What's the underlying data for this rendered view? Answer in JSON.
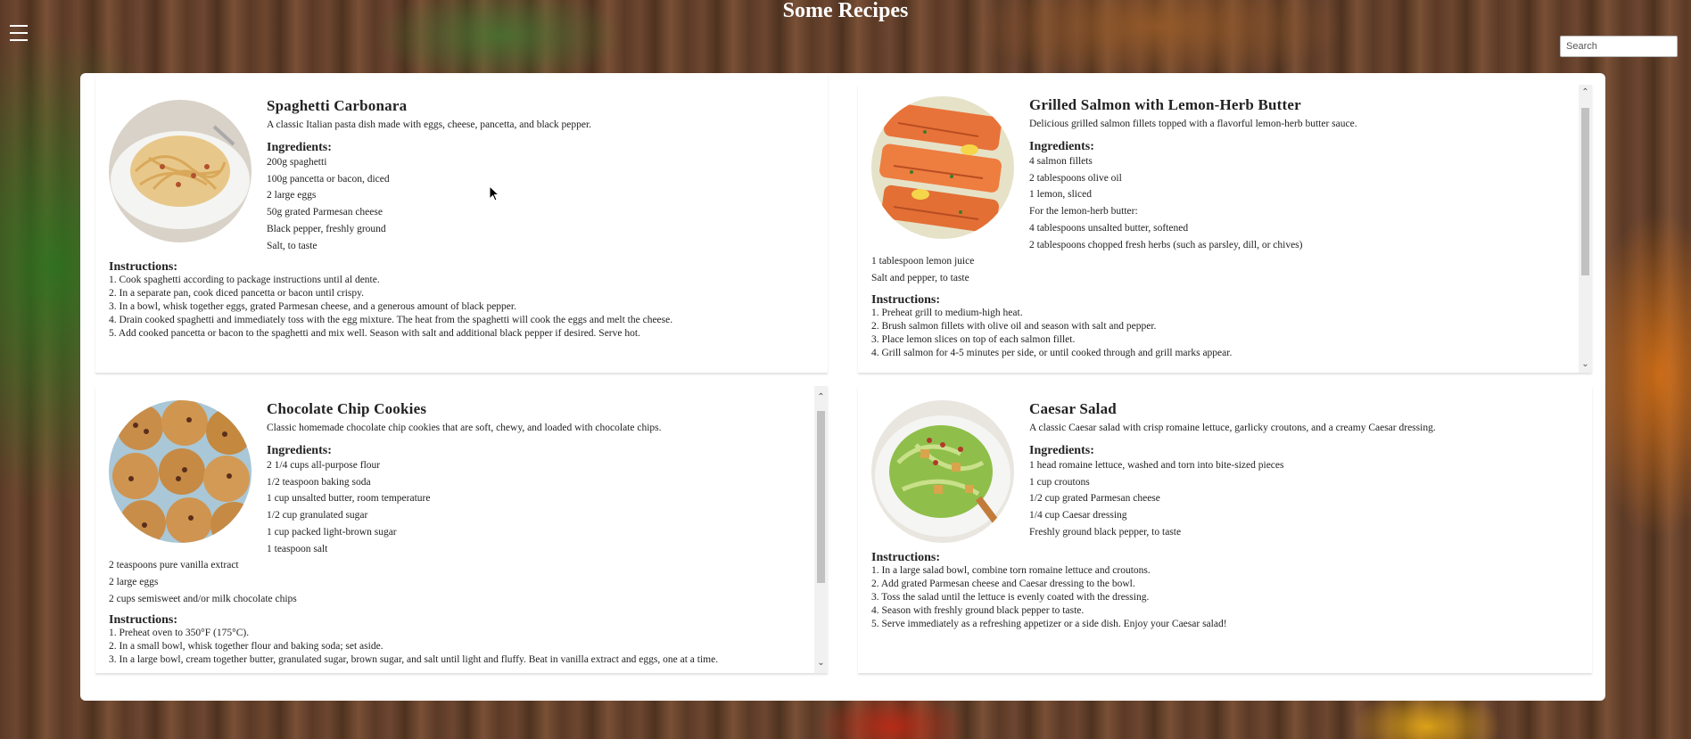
{
  "header": {
    "title": "Some Recipes",
    "search_placeholder": "Search",
    "menu_icon": "hamburger-menu-icon"
  },
  "recipes": [
    {
      "title": "Spaghetti Carbonara",
      "description": "A classic Italian pasta dish made with eggs, cheese, pancetta, and black pepper.",
      "ingredients_label": "Ingredients:",
      "ingredients": [
        "200g spaghetti",
        "100g pancetta or bacon, diced",
        "2 large eggs",
        "50g grated Parmesan cheese",
        "Black pepper, freshly ground",
        "Salt, to taste"
      ],
      "instructions_label": "Instructions:",
      "instructions": [
        "1. Cook spaghetti according to package instructions until al dente.",
        "2. In a separate pan, cook diced pancetta or bacon until crispy.",
        "3. In a bowl, whisk together eggs, grated Parmesan cheese, and a generous amount of black pepper.",
        "4. Drain cooked spaghetti and immediately toss with the egg mixture. The heat from the spaghetti will cook the eggs and melt the cheese.",
        "5. Add cooked pancetta or bacon to the spaghetti and mix well. Season with salt and additional black pepper if desired. Serve hot."
      ]
    },
    {
      "title": "Grilled Salmon with Lemon-Herb Butter",
      "description": "Delicious grilled salmon fillets topped with a flavorful lemon-herb butter sauce.",
      "ingredients_label": "Ingredients:",
      "ingredients": [
        "4 salmon fillets",
        "2 tablespoons olive oil",
        "1 lemon, sliced",
        "For the lemon-herb butter:",
        "4 tablespoons unsalted butter, softened",
        "2 tablespoons chopped fresh herbs (such as parsley, dill, or chives)",
        "1 tablespoon lemon juice",
        "Salt and pepper, to taste"
      ],
      "instructions_label": "Instructions:",
      "instructions": [
        "1. Preheat grill to medium-high heat.",
        "2. Brush salmon fillets with olive oil and season with salt and pepper.",
        "3. Place lemon slices on top of each salmon fillet.",
        "4. Grill salmon for 4-5 minutes per side, or until cooked through and grill marks appear."
      ]
    },
    {
      "title": "Chocolate Chip Cookies",
      "description": "Classic homemade chocolate chip cookies that are soft, chewy, and loaded with chocolate chips.",
      "ingredients_label": "Ingredients:",
      "ingredients": [
        "2 1/4 cups all-purpose flour",
        "1/2 teaspoon baking soda",
        "1 cup unsalted butter, room temperature",
        "1/2 cup granulated sugar",
        "1 cup packed light-brown sugar",
        "1 teaspoon salt",
        "2 teaspoons pure vanilla extract",
        "2 large eggs",
        "2 cups semisweet and/or milk chocolate chips"
      ],
      "instructions_label": "Instructions:",
      "instructions": [
        "1. Preheat oven to 350°F (175°C).",
        "2. In a small bowl, whisk together flour and baking soda; set aside.",
        "3. In a large bowl, cream together butter, granulated sugar, brown sugar, and salt until light and fluffy. Beat in vanilla extract and eggs, one at a time."
      ]
    },
    {
      "title": "Caesar Salad",
      "description": "A classic Caesar salad with crisp romaine lettuce, garlicky croutons, and a creamy Caesar dressing.",
      "ingredients_label": "Ingredients:",
      "ingredients": [
        "1 head romaine lettuce, washed and torn into bite-sized pieces",
        "1 cup croutons",
        "1/2 cup grated Parmesan cheese",
        "1/4 cup Caesar dressing",
        "Freshly ground black pepper, to taste"
      ],
      "instructions_label": "Instructions:",
      "instructions": [
        "1. In a large salad bowl, combine torn romaine lettuce and croutons.",
        "2. Add grated Parmesan cheese and Caesar dressing to the bowl.",
        "3. Toss the salad until the lettuce is evenly coated with the dressing.",
        "4. Season with freshly ground black pepper to taste.",
        "5. Serve immediately as a refreshing appetizer or a side dish. Enjoy your Caesar salad!"
      ]
    }
  ]
}
